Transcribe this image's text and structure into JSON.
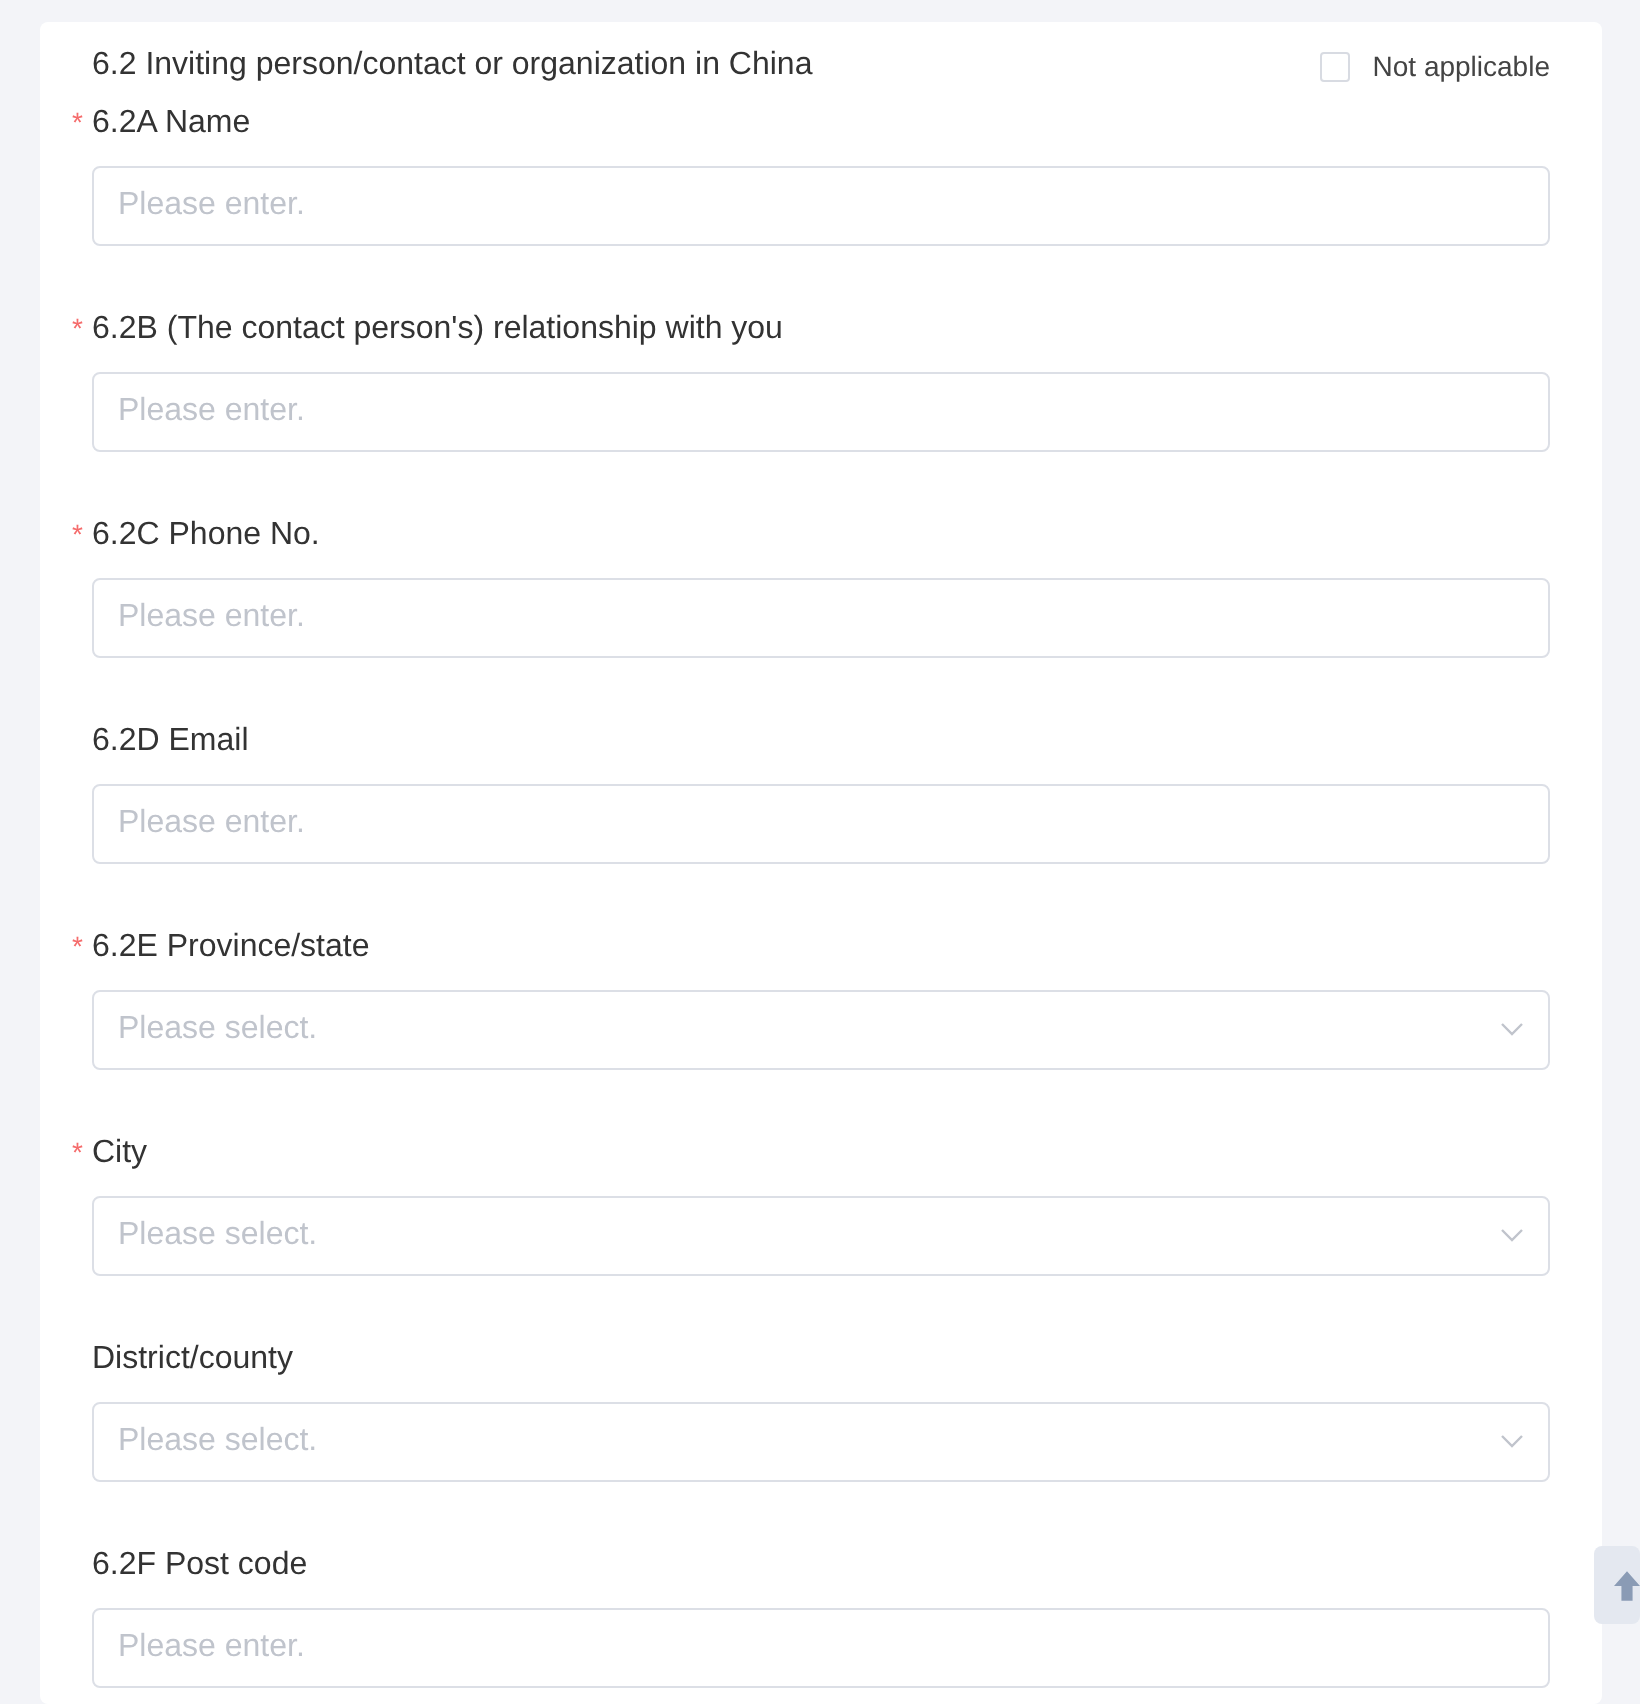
{
  "section": {
    "title": "6.2 Inviting person/contact or organization in China",
    "not_applicable": {
      "label": "Not applicable",
      "checked": false
    }
  },
  "fields": [
    {
      "kind": "input",
      "required_mark": "*",
      "label": "6.2A Name",
      "placeholder": "Please enter."
    },
    {
      "kind": "input",
      "required_mark": "*",
      "label": "6.2B (The contact person's) relationship with you",
      "placeholder": "Please enter."
    },
    {
      "kind": "input",
      "required_mark": "*",
      "label": "6.2C Phone No.",
      "placeholder": "Please enter."
    },
    {
      "kind": "input",
      "label": "6.2D Email",
      "placeholder": "Please enter."
    },
    {
      "kind": "select",
      "required_mark": "*",
      "label": "6.2E Province/state",
      "placeholder": "Please select."
    },
    {
      "kind": "select",
      "required_mark": "*",
      "label": "City",
      "placeholder": "Please select."
    },
    {
      "kind": "select",
      "label": "District/county",
      "placeholder": "Please select."
    },
    {
      "kind": "input",
      "label": "6.2F Post code",
      "placeholder": "Please enter."
    }
  ]
}
